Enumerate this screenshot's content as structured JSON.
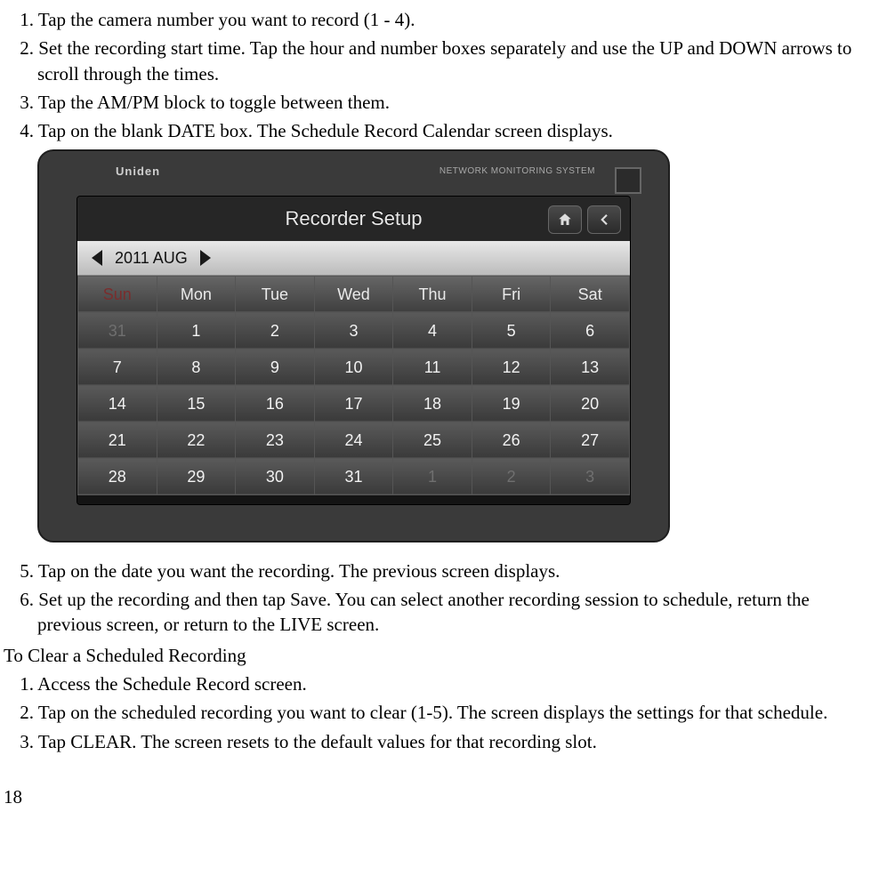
{
  "steps_a": [
    {
      "n": "1.",
      "t": "Tap the camera number you want to record (1 - 4)."
    },
    {
      "n": "2.",
      "t": "Set the recording start time. Tap the hour and number boxes separately and use the UP and DOWN arrows to scroll through the times."
    },
    {
      "n": "3.",
      "t": "Tap the AM/PM block to toggle between them."
    },
    {
      "n": "4.",
      "t": "Tap on the blank DATE box. The Schedule Record Calendar screen displays."
    }
  ],
  "steps_b": [
    {
      "n": "5.",
      "t": "Tap on the date you want the recording. The previous screen displays."
    },
    {
      "n": "6.",
      "t": "Set up the recording and then tap Save. You can select another recording session to schedule, return the previous screen, or return to the LIVE screen."
    }
  ],
  "subhead": "To Clear a Scheduled Recording",
  "steps_c": [
    {
      "n": "1.",
      "t": "Access the Schedule Record screen."
    },
    {
      "n": "2.",
      "t": "Tap on the scheduled recording you want to clear (1-5). The screen displays the settings for that schedule."
    },
    {
      "n": "3.",
      "t": "Tap CLEAR. The screen resets to the default values for that recording slot."
    }
  ],
  "page_number": "18",
  "device": {
    "brand": "Uniden",
    "system_label": "NETWORK MONITORING SYSTEM",
    "app_title": "Recorder Setup",
    "month_label": "2011 AUG",
    "day_headers": [
      "Sun",
      "Mon",
      "Tue",
      "Wed",
      "Thu",
      "Fri",
      "Sat"
    ],
    "rows": [
      [
        {
          "v": "31",
          "dim": true
        },
        {
          "v": "1"
        },
        {
          "v": "2"
        },
        {
          "v": "3"
        },
        {
          "v": "4"
        },
        {
          "v": "5"
        },
        {
          "v": "6"
        }
      ],
      [
        {
          "v": "7"
        },
        {
          "v": "8"
        },
        {
          "v": "9"
        },
        {
          "v": "10"
        },
        {
          "v": "11"
        },
        {
          "v": "12"
        },
        {
          "v": "13"
        }
      ],
      [
        {
          "v": "14"
        },
        {
          "v": "15"
        },
        {
          "v": "16"
        },
        {
          "v": "17"
        },
        {
          "v": "18"
        },
        {
          "v": "19"
        },
        {
          "v": "20"
        }
      ],
      [
        {
          "v": "21"
        },
        {
          "v": "22"
        },
        {
          "v": "23"
        },
        {
          "v": "24"
        },
        {
          "v": "25"
        },
        {
          "v": "26"
        },
        {
          "v": "27"
        }
      ],
      [
        {
          "v": "28"
        },
        {
          "v": "29"
        },
        {
          "v": "30"
        },
        {
          "v": "31"
        },
        {
          "v": "1",
          "dim": true
        },
        {
          "v": "2",
          "dim": true
        },
        {
          "v": "3",
          "dim": true
        }
      ]
    ]
  }
}
